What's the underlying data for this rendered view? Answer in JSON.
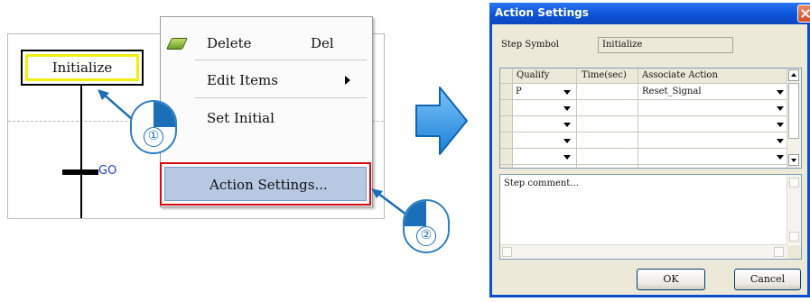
{
  "sfc": {
    "step_label": "Initialize",
    "transition_label": "GO"
  },
  "context_menu": {
    "items": [
      {
        "label": "Delete",
        "shortcut": "Del",
        "icon": "eraser-icon"
      },
      {
        "label": "Edit Items",
        "submenu": true
      },
      {
        "label": "Set Initial"
      },
      {
        "label": "Action Settings...",
        "highlighted": true
      }
    ]
  },
  "callouts": {
    "step1_number": "①",
    "step2_number": "②"
  },
  "dialog": {
    "title": "Action Settings",
    "step_symbol_label": "Step Symbol",
    "step_symbol_value": "Initialize",
    "grid": {
      "columns": [
        "Qualify",
        "Time(sec)",
        "Associate Action"
      ],
      "rows": [
        {
          "qualify": "P",
          "time": "",
          "action": "Reset_Signal"
        },
        {
          "qualify": "",
          "time": "",
          "action": ""
        },
        {
          "qualify": "",
          "time": "",
          "action": ""
        },
        {
          "qualify": "",
          "time": "",
          "action": ""
        },
        {
          "qualify": "",
          "time": "",
          "action": ""
        }
      ]
    },
    "comment_placeholder": "Step comment...",
    "ok_label": "OK",
    "cancel_label": "Cancel"
  },
  "colors": {
    "highlight_border": "#d70b14",
    "menu_highlight": "#b7c8e2",
    "step_inner_border": "#f2ee10",
    "callout_blue": "#1b6fb8",
    "flow_arrow": "#1e88e5",
    "titlebar": "#0a51d6"
  }
}
